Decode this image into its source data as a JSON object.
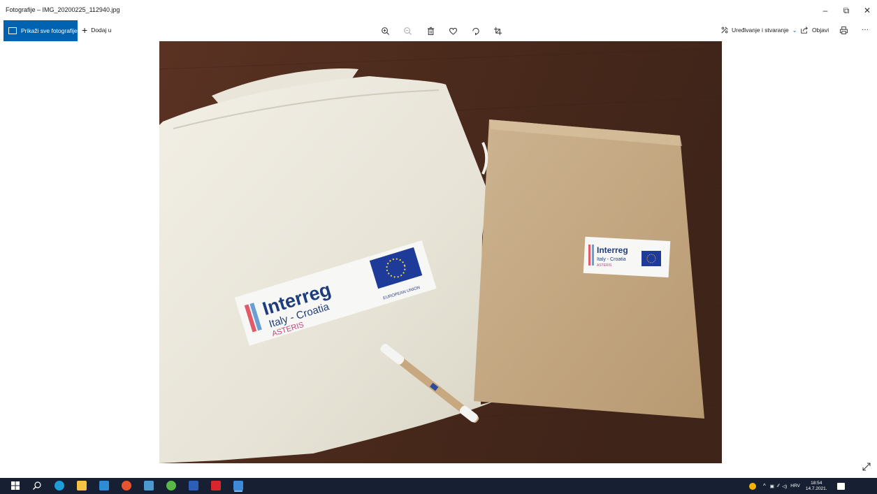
{
  "window": {
    "title": "Fotografije – IMG_20200225_112940.jpg",
    "minimize_label": "–",
    "maximize_label": "⧉",
    "close_label": "✕"
  },
  "toolbar": {
    "show_all_label": "Prikaži sve fotografije",
    "add_label": "Dodaj u",
    "edit_label": "Uređivanje i stvaranje",
    "share_label": "Objavi",
    "more_label": "···"
  },
  "photo": {
    "bag_logo_title": "Interreg",
    "bag_logo_subtitle": "Italy - Croatia",
    "bag_logo_project": "ASTERIS",
    "bag_logo_eu": "EUROPEAN UNION",
    "folder_logo_title": "Interreg",
    "folder_logo_subtitle": "Italy - Croatia",
    "folder_logo_project": "ASTERIS"
  },
  "taskbar": {
    "language": "HRV",
    "time": "18:54",
    "date": "14.7.2021."
  },
  "colors": {
    "accent": "#0063b1",
    "taskbar": "#172033"
  }
}
